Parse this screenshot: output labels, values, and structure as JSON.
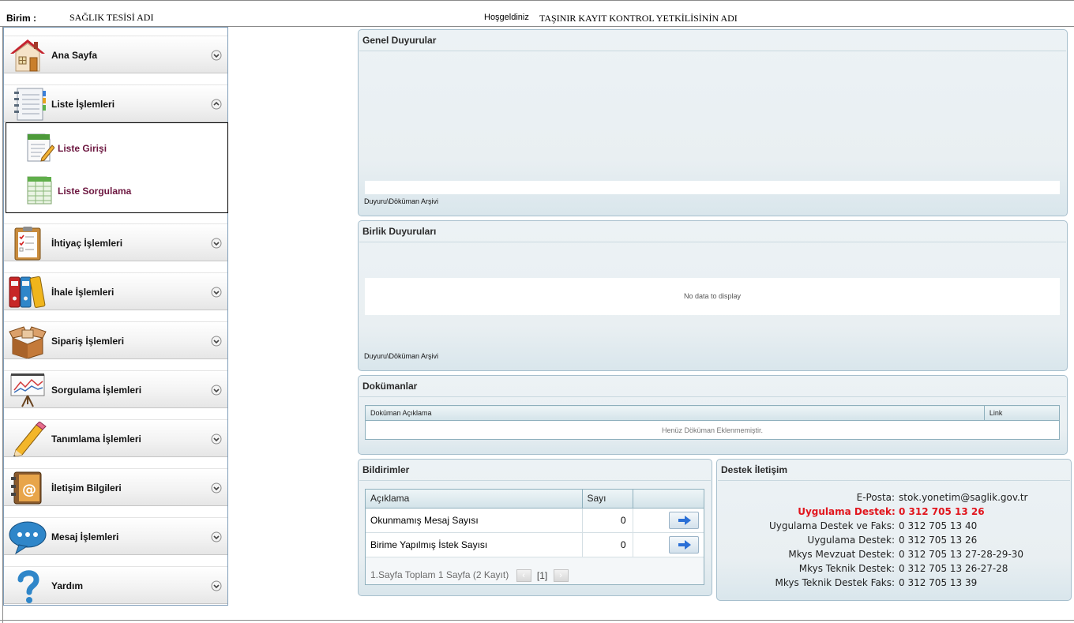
{
  "header": {
    "birim_label": "Birim :",
    "birim_value": "SAĞLIK TESİSİ ADI",
    "welcome_text": "Hoşgeldiniz",
    "welcome_name": "TAŞINIR KAYIT KONTROL YETKİLİSİNİN ADI"
  },
  "menu": {
    "items": [
      {
        "label": "Ana Sayfa",
        "icon": "house-icon",
        "state": "collapsed"
      },
      {
        "label": "Liste İşlemleri",
        "icon": "notebook-icon",
        "state": "expanded"
      },
      {
        "label": "İhtiyaç İşlemleri",
        "icon": "clipboard-checklist-icon",
        "state": "collapsed"
      },
      {
        "label": "İhale İşlemleri",
        "icon": "binders-icon",
        "state": "collapsed"
      },
      {
        "label": "Sipariş İşlemleri",
        "icon": "open-box-icon",
        "state": "collapsed"
      },
      {
        "label": "Sorgulama İşlemleri",
        "icon": "chart-easel-icon",
        "state": "collapsed"
      },
      {
        "label": "Tanımlama İşlemleri",
        "icon": "pencil-icon",
        "state": "collapsed"
      },
      {
        "label": "İletişim Bilgileri",
        "icon": "address-book-icon",
        "state": "collapsed"
      },
      {
        "label": "Mesaj İşlemleri",
        "icon": "speech-bubble-icon",
        "state": "collapsed"
      },
      {
        "label": "Yardım",
        "icon": "question-mark-icon",
        "state": "collapsed"
      }
    ],
    "submenu": [
      {
        "label": "Liste Girişi",
        "icon": "edit-document-icon"
      },
      {
        "label": "Liste Sorgulama",
        "icon": "spreadsheet-icon"
      }
    ]
  },
  "genel_duyurular": {
    "title": "Genel Duyurular",
    "archive_link": "Duyuru\\Döküman Arşivi"
  },
  "birlik_duyurulari": {
    "title": "Birlik Duyuruları",
    "empty_text": "No data to display",
    "archive_link": "Duyuru\\Döküman Arşivi"
  },
  "dokumanlar": {
    "title": "Dokümanlar",
    "columns": [
      "Doküman Açıklama",
      "Link"
    ],
    "empty_text": "Henüz Döküman Eklenmemiştir."
  },
  "bildirimler": {
    "title": "Bildirimler",
    "columns": [
      "Açıklama",
      "Sayı",
      ""
    ],
    "rows": [
      {
        "aciklama": "Okunmamış Mesaj Sayısı",
        "sayi": "0"
      },
      {
        "aciklama": "Birime Yapılmış İstek Sayısı",
        "sayi": "0"
      }
    ],
    "pager_text": "1.Sayfa Toplam 1 Sayfa (2 Kayıt)",
    "pager_current": "[1]"
  },
  "destek": {
    "title": "Destek İletişim",
    "lines": [
      {
        "key": "E-Posta",
        "value": "stok.yonetim@saglik.gov.tr",
        "highlight": false
      },
      {
        "key": "Uygulama Destek",
        "value": "0 312 705 13 26",
        "highlight": true
      },
      {
        "key": "Uygulama Destek ve Faks",
        "value": "0 312 705 13 40",
        "highlight": false
      },
      {
        "key": "Uygulama Destek",
        "value": "0 312 705 13 26",
        "highlight": false
      },
      {
        "key": "Mkys Mevzuat Destek",
        "value": "0 312 705 13 27-28-29-30",
        "highlight": false
      },
      {
        "key": "Mkys Teknik Destek",
        "value": "0 312 705 13 26-27-28",
        "highlight": false
      },
      {
        "key": "Mkys Teknik Destek Faks",
        "value": "0 312 705 13 39",
        "highlight": false
      }
    ]
  },
  "colors": {
    "panel_border": "#a7bfcd",
    "panel_bg": "#e9eff2",
    "submenu_text": "#6d1740",
    "highlight_red": "#e1151d",
    "arrow_blue": "#2a6fd6"
  }
}
